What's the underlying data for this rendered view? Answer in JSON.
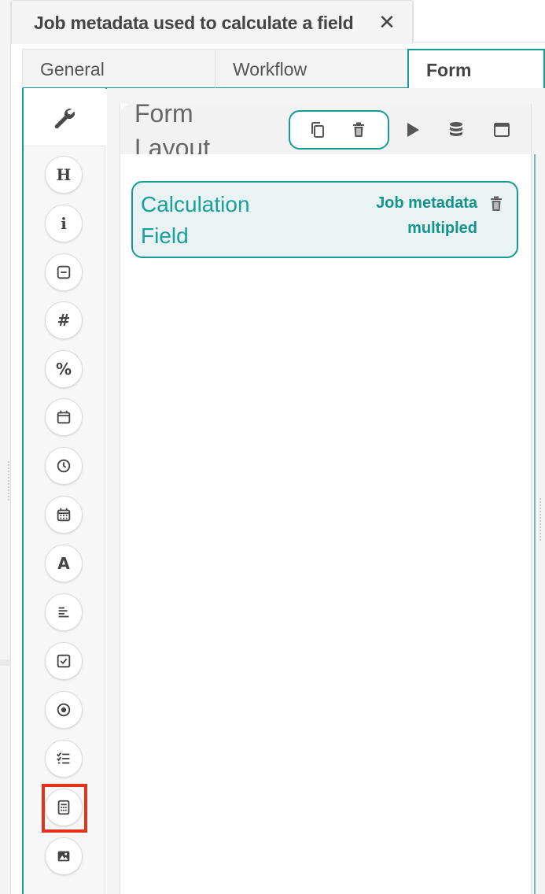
{
  "dialog": {
    "title": "Job metadata used to calculate a field",
    "close_symbol": "✕"
  },
  "tabs": [
    {
      "label": "General",
      "active": false
    },
    {
      "label": "Workflow",
      "active": false
    },
    {
      "label": "Form",
      "active": true
    }
  ],
  "toolbox": {
    "header_icon": "wrench-icon",
    "tools": [
      {
        "icon": "heading-icon",
        "glyph": "H"
      },
      {
        "icon": "info-icon",
        "glyph": "i"
      },
      {
        "icon": "text-field-icon"
      },
      {
        "icon": "number-icon",
        "glyph": "#"
      },
      {
        "icon": "percent-icon",
        "glyph": "%"
      },
      {
        "icon": "date-icon"
      },
      {
        "icon": "time-icon"
      },
      {
        "icon": "datetime-icon"
      },
      {
        "icon": "font-icon",
        "glyph": "A"
      },
      {
        "icon": "text-area-icon"
      },
      {
        "icon": "checkbox-icon"
      },
      {
        "icon": "radio-icon"
      },
      {
        "icon": "checklist-icon"
      },
      {
        "icon": "calculator-icon",
        "highlighted": true
      },
      {
        "icon": "image-icon"
      }
    ],
    "highlight_color": "#e5321b"
  },
  "form_layout": {
    "title": "Form Layout",
    "header_actions": [
      "copy-icon",
      "trash-icon",
      "play-icon",
      "database-icon",
      "window-icon"
    ],
    "fields": [
      {
        "label": "Calculation Field",
        "meta": "Job metadata multipled",
        "action_icon": "trash-icon"
      }
    ]
  },
  "colors": {
    "accent": "#179a95",
    "card_background": "#e9f3f3",
    "text": "#444444"
  }
}
